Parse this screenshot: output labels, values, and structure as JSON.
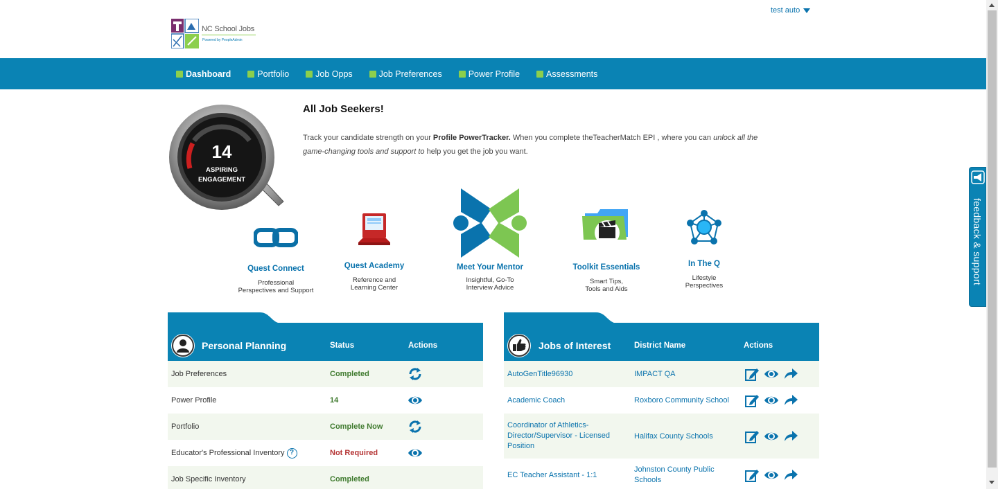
{
  "header": {
    "logo_title": "NC School Jobs",
    "logo_subtitle": "Powered by PeopleAdmin",
    "user_name": "test auto"
  },
  "nav": {
    "items": [
      {
        "label": "Dashboard",
        "active": true
      },
      {
        "label": "Portfolio"
      },
      {
        "label": "Job Opps"
      },
      {
        "label": "Job Preferences"
      },
      {
        "label": "Power Profile"
      },
      {
        "label": "Assessments"
      }
    ]
  },
  "tracker": {
    "score": "14",
    "level_line1": "ASPIRING",
    "level_line2": "ENGAGEMENT"
  },
  "intro": {
    "headline": "All Job Seekers!",
    "text_1": "Track your candidate strength on your ",
    "text_bold": "Profile PowerTracker.",
    "text_2": " When you complete theTeacherMatch EPI , where you can ",
    "text_italic": "unlock all the game-changing tools and support to",
    "text_3": " help you get the job you want."
  },
  "tools": [
    {
      "title": "Quest Connect",
      "desc1": "Professional",
      "desc2": "Perspectives and Support",
      "icon": "chain-link-icon"
    },
    {
      "title": "Quest Academy",
      "desc1": "Reference and",
      "desc2": "Learning Center",
      "icon": "laptop-icon"
    },
    {
      "title": "Meet Your Mentor",
      "desc1": "Insightful, Go-To",
      "desc2": "Interview Advice",
      "icon": "mentor-logo-icon"
    },
    {
      "title": "Toolkit Essentials",
      "desc1": "Smart Tips,",
      "desc2": "Tools and Aids",
      "icon": "folder-clapper-icon"
    },
    {
      "title": "In The Q",
      "desc1": "Lifestyle",
      "desc2": "Perspectives",
      "icon": "network-icon"
    }
  ],
  "personal_planning": {
    "title": "Personal Planning",
    "col_status": "Status",
    "col_actions": "Actions",
    "rows": [
      {
        "name": "Job Preferences",
        "status": "Completed",
        "action": "refresh"
      },
      {
        "name": "Power Profile",
        "status": "14",
        "action": "view"
      },
      {
        "name": "Portfolio",
        "status": "Complete Now",
        "action": "refresh"
      },
      {
        "name": "Educator's Professional Inventory",
        "status": "Not Required",
        "action": "view"
      },
      {
        "name": "Job Specific Inventory",
        "status": "Completed",
        "action": ""
      }
    ]
  },
  "jobs_of_interest": {
    "title": "Jobs of Interest",
    "col_district": "District Name",
    "col_actions": "Actions",
    "rows": [
      {
        "job": "AutoGenTitle96930",
        "district": "IMPACT QA"
      },
      {
        "job": "Academic Coach",
        "district": "Roxboro Community School"
      },
      {
        "job": "Coordinator of Athletics-Director/Supervisor - Licensed Position",
        "job_line1": "Coordinator of Athletics-",
        "job_line2": "Director/Supervisor - Licensed",
        "job_line3": "Position",
        "district": "Halifax County Schools"
      },
      {
        "job": "EC Teacher Assistant - 1:1",
        "district_line1": "Johnston County Public",
        "district_line2": "Schools"
      }
    ]
  },
  "feedback": {
    "label": "feedback & support"
  },
  "colors": {
    "brand_blue": "#0a83b4",
    "accent_green": "#8ccf4d",
    "status_green": "#3f7a2e",
    "status_red": "#b53535"
  }
}
